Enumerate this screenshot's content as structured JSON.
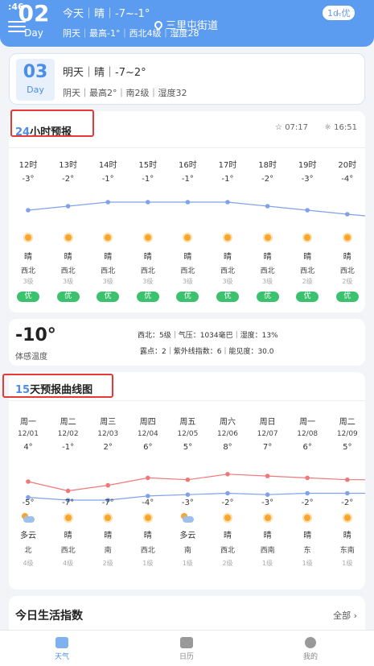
{
  "status": {
    "time": ":46"
  },
  "header": {
    "day_num": "02",
    "day_label": "Day",
    "line1": "今天｜晴｜-7~-1°",
    "line2": "阴天｜最高-1°｜西北4级｜湿度28",
    "location": "三里屯街道",
    "aqi": "1d.̶优"
  },
  "tomorrow": {
    "day_num": "03",
    "day_label": "Day",
    "line1": "明天｜晴｜-7~2°",
    "line2": "阴天｜最高2°｜南2级｜湿度32"
  },
  "hourly": {
    "title_num": "24",
    "title_text": "小时预报",
    "sunrise": "07:17",
    "sunset": "16:51",
    "hours": [
      {
        "time": "12时",
        "temp": "-3°",
        "t": -3,
        "cond": "晴",
        "wind": "西北",
        "level": "3级",
        "aqi": "优"
      },
      {
        "time": "13时",
        "temp": "-2°",
        "t": -2,
        "cond": "晴",
        "wind": "西北",
        "level": "3级",
        "aqi": "优"
      },
      {
        "time": "14时",
        "temp": "-1°",
        "t": -1,
        "cond": "晴",
        "wind": "西北",
        "level": "3级",
        "aqi": "优"
      },
      {
        "time": "15时",
        "temp": "-1°",
        "t": -1,
        "cond": "晴",
        "wind": "西北",
        "level": "3级",
        "aqi": "优"
      },
      {
        "time": "16时",
        "temp": "-1°",
        "t": -1,
        "cond": "晴",
        "wind": "西北",
        "level": "3级",
        "aqi": "优"
      },
      {
        "time": "17时",
        "temp": "-1°",
        "t": -1,
        "cond": "晴",
        "wind": "西北",
        "level": "3级",
        "aqi": "优"
      },
      {
        "time": "18时",
        "temp": "-2°",
        "t": -2,
        "cond": "晴",
        "wind": "西北",
        "level": "3级",
        "aqi": "优"
      },
      {
        "time": "19时",
        "temp": "-3°",
        "t": -3,
        "cond": "晴",
        "wind": "西北",
        "level": "2级",
        "aqi": "优"
      },
      {
        "time": "20时",
        "temp": "-4°",
        "t": -4,
        "cond": "晴",
        "wind": "西北",
        "level": "2级",
        "aqi": "优"
      }
    ]
  },
  "feels": {
    "temp": "-10°",
    "caption": "体感温度",
    "row1": "西北：5级｜气压：1034毫巴｜湿度：13%",
    "row2": "露点：2｜紫外线指数：6｜能见度：30.0"
  },
  "fifteen": {
    "title_num": "15",
    "title_text": "天预报曲线图",
    "days": [
      {
        "week": "周一",
        "date": "12/01",
        "high": "4°",
        "hi": 4,
        "low": "-5°",
        "lo": -5,
        "cond": "多云",
        "icon": "cloud",
        "wind": "北",
        "level": "4级"
      },
      {
        "week": "周二",
        "date": "12/02",
        "high": "-1°",
        "hi": -1,
        "low": "-7°",
        "lo": -7,
        "cond": "晴",
        "icon": "sun",
        "wind": "西北",
        "level": "4级"
      },
      {
        "week": "周三",
        "date": "12/03",
        "high": "2°",
        "hi": 2,
        "low": "-7°",
        "lo": -7,
        "cond": "晴",
        "icon": "sun",
        "wind": "南",
        "level": "2级"
      },
      {
        "week": "周四",
        "date": "12/04",
        "high": "6°",
        "hi": 6,
        "low": "-4°",
        "lo": -4,
        "cond": "晴",
        "icon": "sun",
        "wind": "西北",
        "level": "1级"
      },
      {
        "week": "周五",
        "date": "12/05",
        "high": "5°",
        "hi": 5,
        "low": "-3°",
        "lo": -3,
        "cond": "多云",
        "icon": "cloud",
        "wind": "南",
        "level": "1级"
      },
      {
        "week": "周六",
        "date": "12/06",
        "high": "8°",
        "hi": 8,
        "low": "-2°",
        "lo": -2,
        "cond": "晴",
        "icon": "sun",
        "wind": "西北",
        "level": "2级"
      },
      {
        "week": "周日",
        "date": "12/07",
        "high": "7°",
        "hi": 7,
        "low": "-3°",
        "lo": -3,
        "cond": "晴",
        "icon": "sun",
        "wind": "西南",
        "level": "1级"
      },
      {
        "week": "周一",
        "date": "12/08",
        "high": "6°",
        "hi": 6,
        "low": "-2°",
        "lo": -2,
        "cond": "晴",
        "icon": "sun",
        "wind": "东",
        "level": "1级"
      },
      {
        "week": "周二",
        "date": "12/09",
        "high": "5°",
        "hi": 5,
        "low": "-2°",
        "lo": -2,
        "cond": "晴",
        "icon": "sun",
        "wind": "东南",
        "level": "1级"
      }
    ]
  },
  "life": {
    "title": "今日生活指数",
    "all": "全部 ›"
  },
  "tabs": [
    {
      "label": "天气",
      "icon": "weather-icon",
      "active": true
    },
    {
      "label": "日历",
      "icon": "calendar-icon",
      "active": false
    },
    {
      "label": "我的",
      "icon": "profile-icon",
      "active": false
    }
  ],
  "colors": {
    "accent": "#4a8ee8",
    "high_line": "#f07878",
    "low_line": "#7fa2ea",
    "aqi_good": "#3cc26f",
    "highlight": "#e53935"
  }
}
